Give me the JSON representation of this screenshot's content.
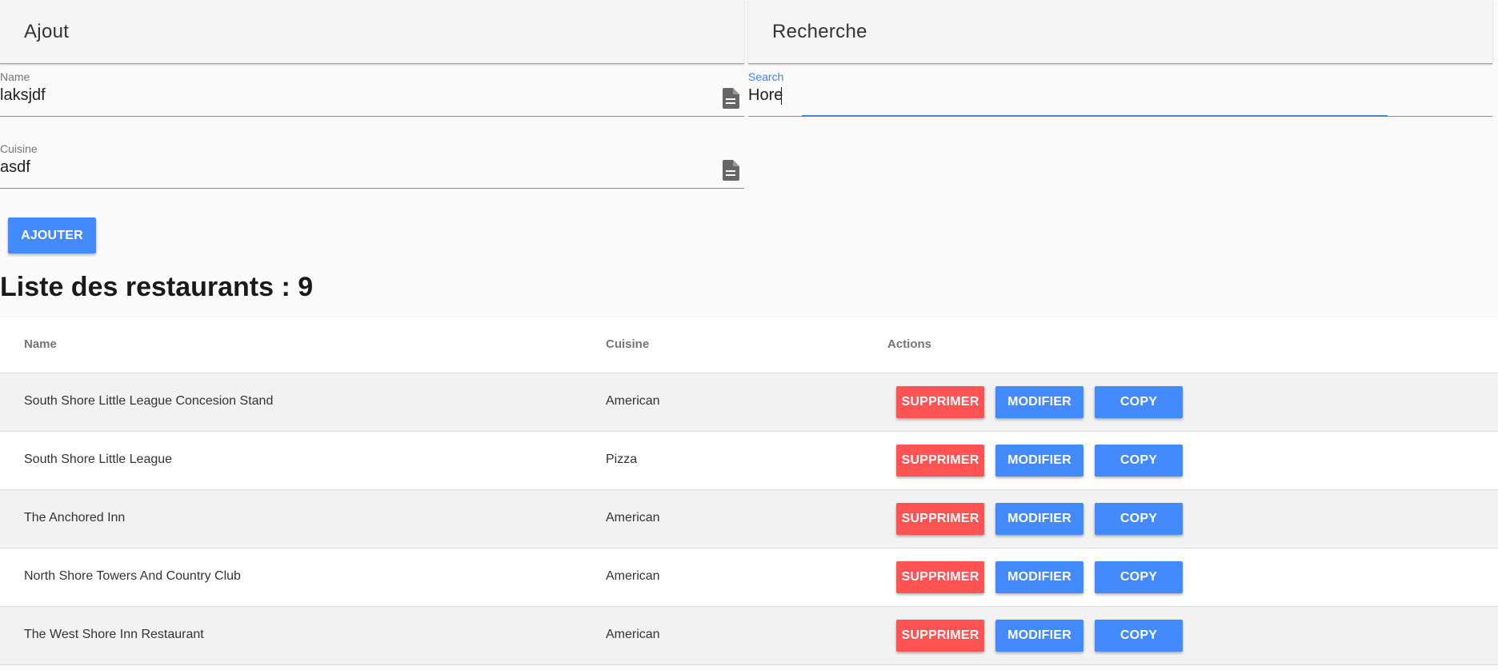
{
  "add_panel": {
    "title": "Ajout",
    "name_label": "Name",
    "name_value": "laksjdf",
    "cuisine_label": "Cuisine",
    "cuisine_value": "asdf",
    "add_button": "AJOUTER"
  },
  "search_panel": {
    "title": "Recherche",
    "search_label": "Search",
    "search_value": "Hore"
  },
  "list": {
    "title": "Liste des restaurants : 9"
  },
  "table": {
    "headers": {
      "name": "Name",
      "cuisine": "Cuisine",
      "actions": "Actions"
    },
    "rows": [
      {
        "name": "South Shore Little League Concesion Stand",
        "cuisine": "American"
      },
      {
        "name": "South Shore Little League",
        "cuisine": "Pizza"
      },
      {
        "name": "The Anchored Inn",
        "cuisine": "American"
      },
      {
        "name": "North Shore Towers And Country Club",
        "cuisine": "American"
      },
      {
        "name": "The West Shore Inn Restaurant",
        "cuisine": "American"
      }
    ],
    "row_actions": {
      "delete": "SUPPRIMER",
      "edit": "MODIFIER",
      "copy": "COPY"
    }
  },
  "colors": {
    "primary": "#448aff",
    "danger": "#ff5252",
    "focus": "#3f86d9"
  },
  "icons": {
    "field_icon": "description-icon"
  }
}
